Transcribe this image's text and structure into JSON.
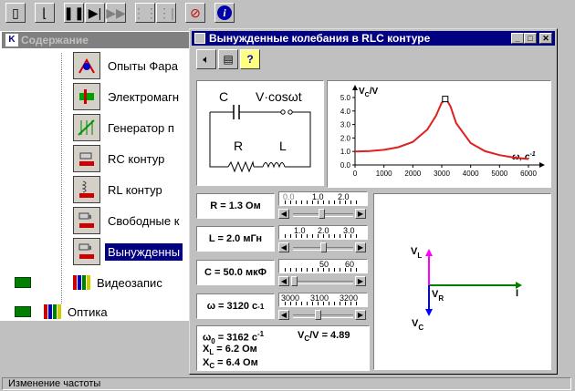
{
  "toc": {
    "title": "Содержание",
    "items": [
      {
        "label": "Опыты Фара"
      },
      {
        "label": "Электромагн"
      },
      {
        "label": "Генератор п"
      },
      {
        "label": "RC контур"
      },
      {
        "label": "RL контур"
      },
      {
        "label": "Свободные к"
      },
      {
        "label": "Вынужденны",
        "selected": true
      },
      {
        "label": "Видеозапис"
      },
      {
        "label": "Оптика"
      }
    ]
  },
  "window": {
    "title": "Вынужденные колебания в RLC контуре"
  },
  "circuit": {
    "c_label": "C",
    "source_label": "V·cosωt",
    "r_label": "R",
    "l_label": "L"
  },
  "params": {
    "r": "R = 1.3 Ом",
    "l": "L = 2.0 мГн",
    "c": "C = 50.0 мкФ",
    "w_prefix": "ω = 3120 с",
    "w_exp": "-1"
  },
  "sliders": {
    "r_ticks": [
      "0.0",
      "1.0",
      "2.0"
    ],
    "l_ticks": [
      "1.0",
      "2.0",
      "3.0"
    ],
    "c_ticks": [
      "50",
      "60"
    ],
    "w_ticks": [
      "3000",
      "3100",
      "3200"
    ],
    "r_value": 1.3,
    "l_value": 2.0,
    "c_value": 50.0,
    "w_value": 3120
  },
  "results": {
    "w0_prefix": "ω",
    "w0_sub": "0",
    "w0_text": " = 3162 с",
    "w0_exp": "-1",
    "ratio_main": "V",
    "ratio_sub": "C",
    "ratio_text": "/V = 4.89",
    "xl_main": "X",
    "xl_sub": "L",
    "xl_text": " = 6.2 Ом",
    "xc_main": "X",
    "xc_sub": "C",
    "xc_text": " = 6.4 Ом"
  },
  "phasor": {
    "vl_main": "V",
    "vl_sub": "L",
    "vr_main": "V",
    "vr_sub": "R",
    "vc_main": "V",
    "vc_sub": "C",
    "i_label": "I"
  },
  "status": {
    "text": "Изменение частоты"
  },
  "colors": {
    "curve": "#e02020",
    "vl": "#ff00ff",
    "vr": "#000000",
    "vc": "#0000ff",
    "i": "#008000",
    "selection": "#000080"
  },
  "chart_data": {
    "type": "line",
    "ylabel_main": "V",
    "ylabel_sub": "C",
    "ylabel_tail": "/V",
    "xlabel": "ω, с",
    "xlabel_exp": "-1",
    "xlim": [
      0,
      6000
    ],
    "ylim": [
      0,
      5.0
    ],
    "x_ticks": [
      "0",
      "1000",
      "2000",
      "3000",
      "4000",
      "5000",
      "6000"
    ],
    "y_ticks": [
      "0.0",
      "1.0",
      "2.0",
      "3.0",
      "4.0",
      "5.0"
    ],
    "x": [
      0,
      500,
      1000,
      1500,
      2000,
      2500,
      2800,
      3000,
      3162,
      3300,
      3500,
      4000,
      4500,
      5000,
      5500,
      6000
    ],
    "values": [
      1.0,
      1.03,
      1.12,
      1.32,
      1.71,
      2.63,
      3.65,
      4.62,
      4.86,
      4.35,
      3.1,
      1.62,
      1.02,
      0.73,
      0.55,
      0.44
    ],
    "marker": {
      "x": 3120,
      "y": 4.89
    }
  }
}
